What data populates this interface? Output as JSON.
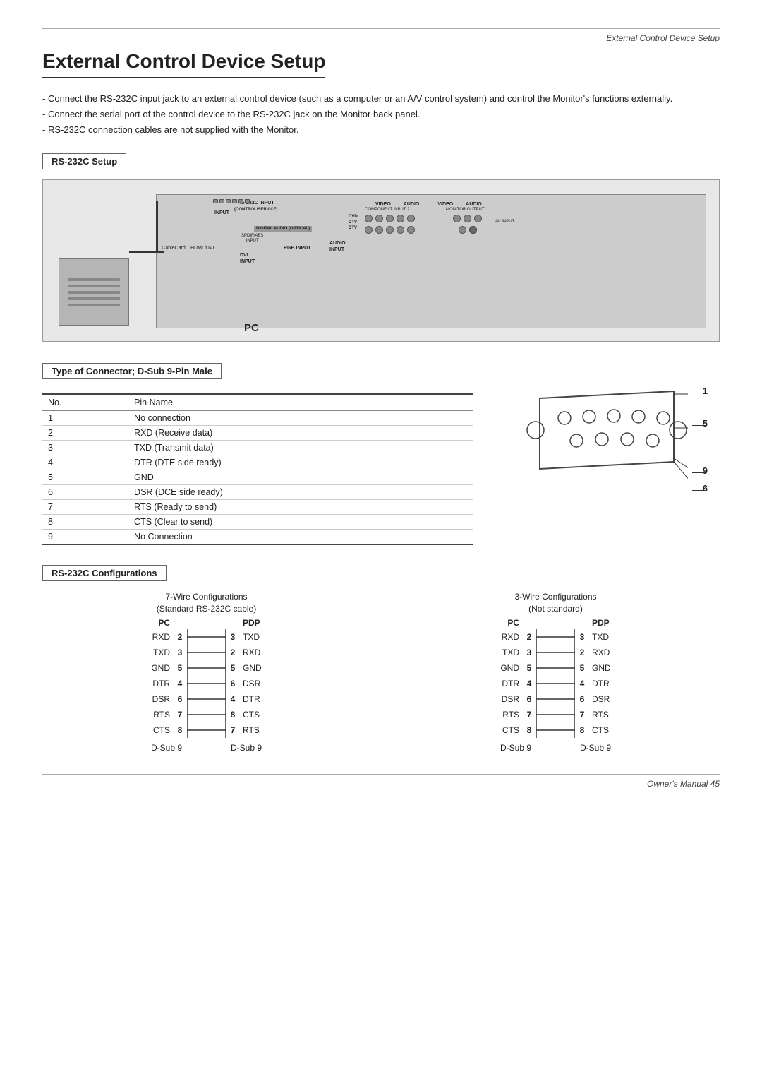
{
  "header": {
    "chapter": "External Control Device Setup",
    "footer": "Owner's Manual  45"
  },
  "title": "External Control Device Setup",
  "intro": [
    "Connect the RS-232C input jack to an external control device (such as a computer or an A/V control system) and control the Monitor's functions externally.",
    "Connect the serial port of the control device to the RS-232C jack on the Monitor back panel.",
    "RS-232C connection cables are not supplied with the Monitor."
  ],
  "rs232c_setup_label": "RS-232C Setup",
  "pc_label": "PC",
  "connector_section_label": "Type of Connector; D-Sub 9-Pin Male",
  "pin_table": {
    "col1": "No.",
    "col2": "Pin Name",
    "rows": [
      {
        "no": "1",
        "name": "No connection"
      },
      {
        "no": "2",
        "name": "RXD (Receive data)"
      },
      {
        "no": "3",
        "name": "TXD (Transmit data)"
      },
      {
        "no": "4",
        "name": "DTR (DTE side ready)"
      },
      {
        "no": "5",
        "name": "GND"
      },
      {
        "no": "6",
        "name": "DSR (DCE side ready)"
      },
      {
        "no": "7",
        "name": "RTS (Ready to send)"
      },
      {
        "no": "8",
        "name": "CTS (Clear to send)"
      },
      {
        "no": "9",
        "name": "No Connection"
      }
    ]
  },
  "d_sub_numbers": {
    "top_right": "1",
    "mid_right": "5",
    "bottom_right": "9",
    "bottom_right2": "6"
  },
  "configs_section_label": "RS-232C Configurations",
  "wire7": {
    "title1": "7-Wire Configurations",
    "title2": "(Standard RS-232C cable)",
    "pc_label": "PC",
    "pdp_label": "PDP",
    "dsub_left": "D-Sub 9",
    "dsub_right": "D-Sub 9",
    "rows": [
      {
        "pc_label": "RXD",
        "pc_num": "2",
        "pdp_num": "3",
        "pdp_label": "TXD"
      },
      {
        "pc_label": "TXD",
        "pc_num": "3",
        "pdp_num": "2",
        "pdp_label": "RXD"
      },
      {
        "pc_label": "GND",
        "pc_num": "5",
        "pdp_num": "5",
        "pdp_label": "GND"
      },
      {
        "pc_label": "DTR",
        "pc_num": "4",
        "pdp_num": "6",
        "pdp_label": "DSR"
      },
      {
        "pc_label": "DSR",
        "pc_num": "6",
        "pdp_num": "4",
        "pdp_label": "DTR"
      },
      {
        "pc_label": "RTS",
        "pc_num": "7",
        "pdp_num": "8",
        "pdp_label": "CTS"
      },
      {
        "pc_label": "CTS",
        "pc_num": "8",
        "pdp_num": "7",
        "pdp_label": "RTS"
      }
    ]
  },
  "wire3": {
    "title1": "3-Wire Configurations",
    "title2": "(Not standard)",
    "pc_label": "PC",
    "pdp_label": "PDP",
    "dsub_left": "D-Sub 9",
    "dsub_right": "D-Sub 9",
    "rows": [
      {
        "pc_label": "RXD",
        "pc_num": "2",
        "pdp_num": "3",
        "pdp_label": "TXD"
      },
      {
        "pc_label": "TXD",
        "pc_num": "3",
        "pdp_num": "2",
        "pdp_label": "RXD"
      },
      {
        "pc_label": "GND",
        "pc_num": "5",
        "pdp_num": "5",
        "pdp_label": "GND"
      },
      {
        "pc_label": "DTR",
        "pc_num": "4",
        "pdp_num": "4",
        "pdp_label": "DTR"
      },
      {
        "pc_label": "DSR",
        "pc_num": "6",
        "pdp_num": "6",
        "pdp_label": "DSR"
      },
      {
        "pc_label": "RTS",
        "pc_num": "7",
        "pdp_num": "7",
        "pdp_label": "RTS"
      },
      {
        "pc_label": "CTS",
        "pc_num": "8",
        "pdp_num": "8",
        "pdp_label": "CTS"
      }
    ]
  }
}
